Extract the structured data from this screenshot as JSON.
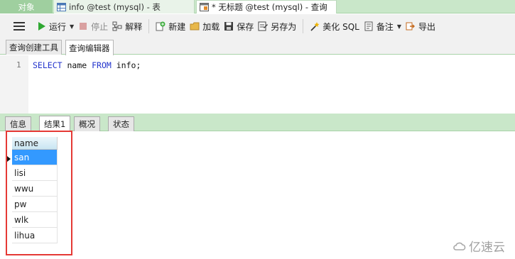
{
  "tabs": [
    {
      "label": "对象"
    },
    {
      "label": "info @test (mysql) - 表"
    },
    {
      "label": "* 无标题 @test (mysql) - 查询"
    }
  ],
  "toolbar": {
    "run": "运行",
    "stop": "停止",
    "explain": "解释",
    "new": "新建",
    "load": "加载",
    "save": "保存",
    "save_as": "另存为",
    "beautify": "美化 SQL",
    "comment": "备注",
    "export": "导出"
  },
  "subtabs": [
    {
      "label": "查询创建工具"
    },
    {
      "label": "查询编辑器"
    }
  ],
  "editor": {
    "line_number": "1",
    "code": {
      "kw1": "SELECT",
      "col": " name ",
      "kw2": "FROM",
      "rest": " info;"
    }
  },
  "result_tabs": [
    {
      "label": "信息"
    },
    {
      "label": "结果1"
    },
    {
      "label": "概况"
    },
    {
      "label": "状态"
    }
  ],
  "result": {
    "column": "name",
    "rows": [
      "san",
      "lisi",
      "wwu",
      "pw",
      "wlk",
      "lihua"
    ]
  },
  "watermark": "亿速云",
  "colors": {
    "selection": "#3399ff",
    "highlight": "#e53935",
    "tab_strip": "#c9e7c9"
  }
}
